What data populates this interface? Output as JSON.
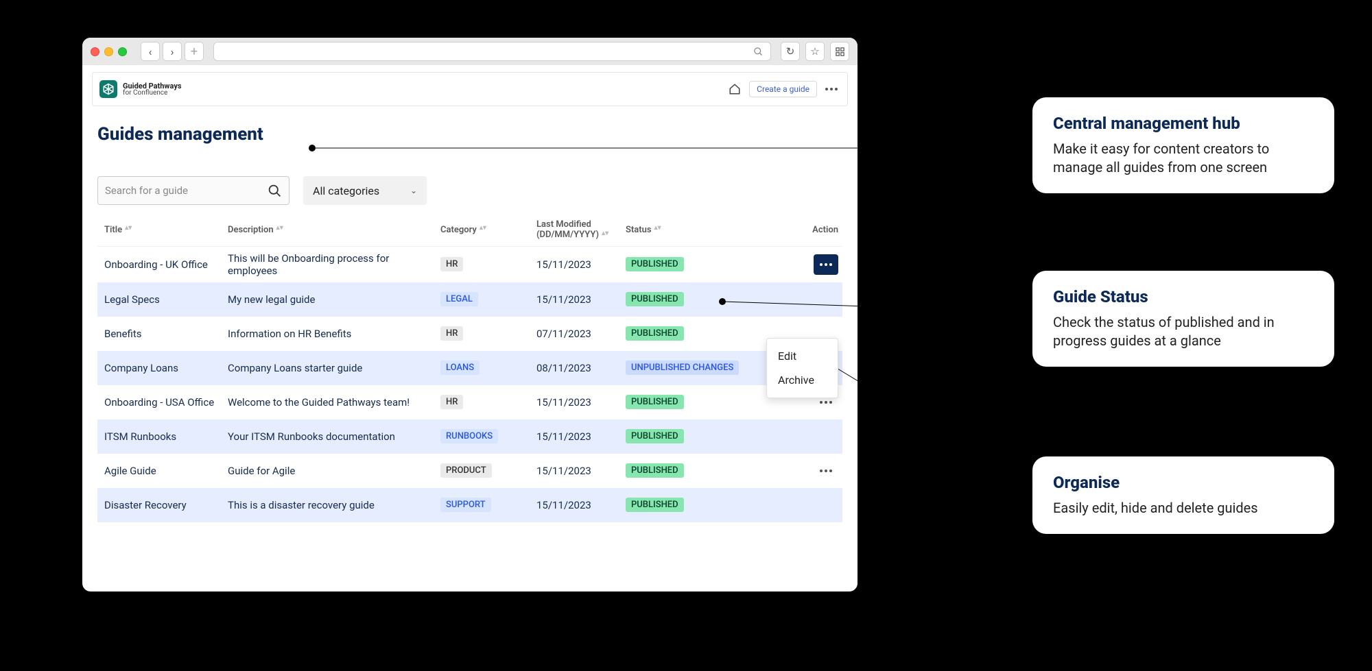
{
  "brand": {
    "line1": "Guided Pathways",
    "line2": "for Confluence"
  },
  "header": {
    "create": "Create a guide"
  },
  "page": {
    "title": "Guides management"
  },
  "search": {
    "placeholder": "Search for a guide"
  },
  "category_filter": {
    "label": "All categories"
  },
  "columns": {
    "title": "Title",
    "description": "Description",
    "category": "Category",
    "last_modified": "Last Modified",
    "last_modified_fmt": "(DD/MM/YYYY)",
    "status": "Status",
    "action": "Action"
  },
  "rows": [
    {
      "title": "Onboarding - UK Office",
      "desc": "This will be Onboarding process for employees",
      "cat": "HR",
      "cat_cls": "cat-hr",
      "date": "15/11/2023",
      "status": "PUBLISHED",
      "status_cls": "s-pub",
      "alt": false,
      "action": "active"
    },
    {
      "title": "Legal Specs",
      "desc": "My new legal guide",
      "cat": "LEGAL",
      "cat_cls": "cat-legal",
      "date": "15/11/2023",
      "status": "PUBLISHED",
      "status_cls": "s-pub",
      "alt": true,
      "action": "hidden"
    },
    {
      "title": "Benefits",
      "desc": "Information on HR Benefits",
      "cat": "HR",
      "cat_cls": "cat-hr",
      "date": "07/11/2023",
      "status": "PUBLISHED",
      "status_cls": "s-pub",
      "alt": false,
      "action": "hidden"
    },
    {
      "title": "Company Loans",
      "desc": "Company Loans starter guide",
      "cat": "LOANS",
      "cat_cls": "cat-loans",
      "date": "08/11/2023",
      "status": "UNPUBLISHED CHANGES",
      "status_cls": "s-unp",
      "alt": true,
      "action": "hidden"
    },
    {
      "title": "Onboarding - USA Office",
      "desc": "Welcome to the Guided Pathways team!",
      "cat": "HR",
      "cat_cls": "cat-hr",
      "date": "15/11/2023",
      "status": "PUBLISHED",
      "status_cls": "s-pub",
      "alt": false,
      "action": "dots"
    },
    {
      "title": "ITSM Runbooks",
      "desc": "Your ITSM Runbooks documentation",
      "cat": "RUNBOOKS",
      "cat_cls": "cat-runbooks",
      "date": "15/11/2023",
      "status": "PUBLISHED",
      "status_cls": "s-pub",
      "alt": true,
      "action": "hidden"
    },
    {
      "title": "Agile Guide",
      "desc": "Guide for Agile",
      "cat": "PRODUCT",
      "cat_cls": "cat-product",
      "date": "15/11/2023",
      "status": "PUBLISHED",
      "status_cls": "s-pub",
      "alt": false,
      "action": "dots"
    },
    {
      "title": "Disaster Recovery",
      "desc": "This is a disaster recovery guide",
      "cat": "SUPPORT",
      "cat_cls": "cat-support",
      "date": "15/11/2023",
      "status": "PUBLISHED",
      "status_cls": "s-pub",
      "alt": true,
      "action": "hidden"
    }
  ],
  "menu": {
    "edit": "Edit",
    "archive": "Archive"
  },
  "callouts": {
    "c1": {
      "title": "Central management hub",
      "body": "Make it easy for content creators to manage all guides from one screen"
    },
    "c2": {
      "title": "Guide Status",
      "body": "Check the status of published and in progress guides at a glance"
    },
    "c3": {
      "title": "Organise",
      "body": "Easily edit, hide and delete guides"
    }
  }
}
